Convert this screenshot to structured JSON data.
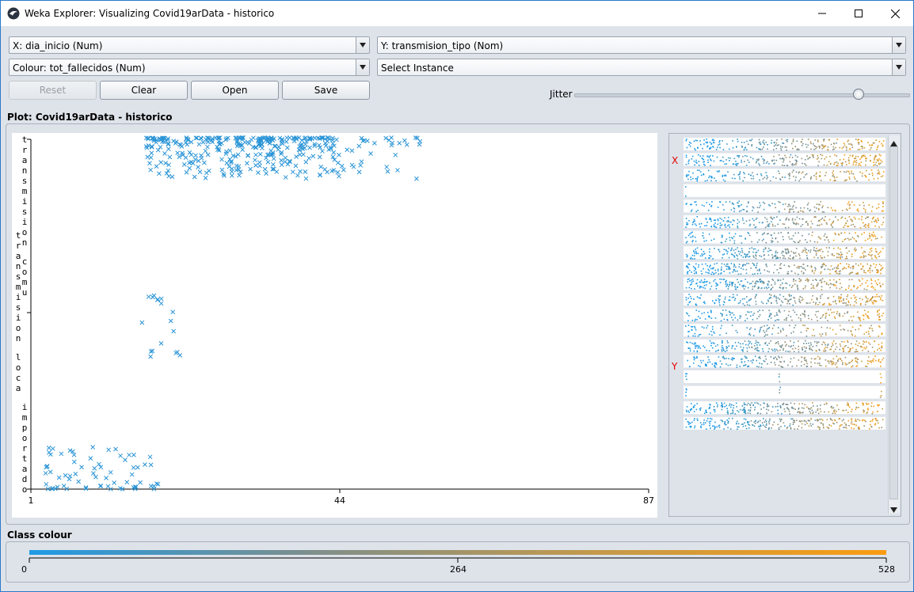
{
  "window": {
    "title": "Weka Explorer: Visualizing Covid19arData - historico",
    "controls": [
      "minimize-icon",
      "maximize-icon",
      "close-icon"
    ]
  },
  "selectors": {
    "x_axis": "X: dia_inicio (Num)",
    "y_axis": "Y: transmision_tipo (Nom)",
    "colour": "Colour: tot_fallecidos (Num)",
    "instance": "Select Instance"
  },
  "buttons": {
    "reset": "Reset",
    "clear": "Clear",
    "open": "Open",
    "save": "Save"
  },
  "jitter": {
    "label": "Jitter",
    "value": 0.85
  },
  "plot": {
    "title": "Plot: Covid19arData - historico",
    "x_ticks": [
      "1",
      "44",
      "87"
    ],
    "y_categories": [
      "transmision_comunitaria",
      "transmision_local",
      "importado"
    ],
    "y_labels_vertical": [
      "transmision",
      "tn comu",
      "transmision loca",
      "importado"
    ]
  },
  "matrix": {
    "x_marker": "X",
    "y_marker": "Y",
    "row_count": 19
  },
  "class_colour": {
    "label": "Class colour",
    "min": "0",
    "mid": "264",
    "max": "528",
    "low_color": "#1f9ae6",
    "high_color": "#fb9c10"
  },
  "colors": {
    "point": "#2a94d6",
    "accent": "#2a78c9"
  }
}
